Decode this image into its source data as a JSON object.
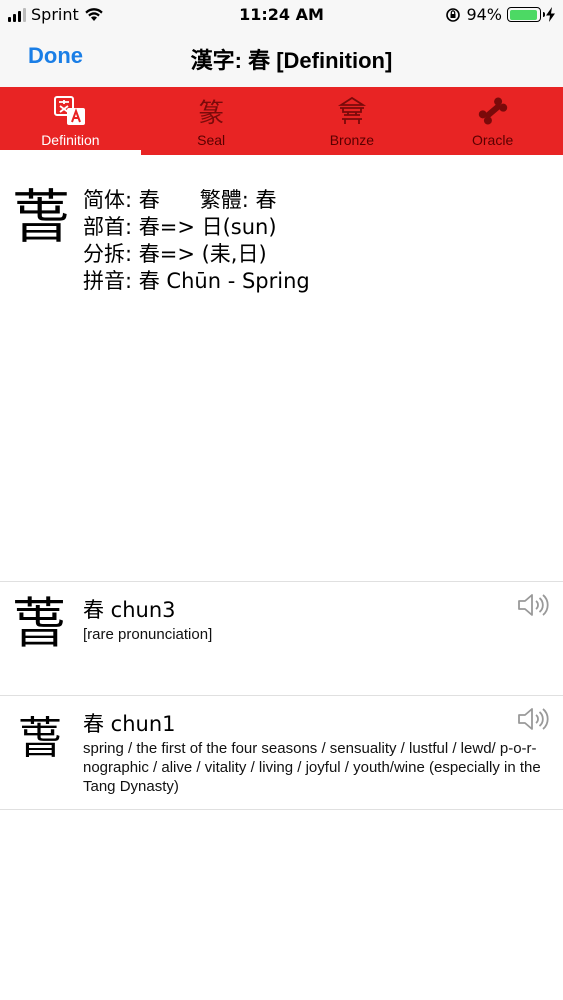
{
  "status": {
    "carrier": "Sprint",
    "time": "11:24 AM",
    "battery": "94%",
    "battery_level": 0.94,
    "icons": [
      "signal-icon",
      "wifi-icon",
      "orientation-lock-icon",
      "battery-icon",
      "charging-icon"
    ]
  },
  "nav": {
    "done_label": "Done",
    "title": "漢字: 春 [Definition]"
  },
  "tabs": [
    {
      "label": "Definition",
      "icon": "translate-icon",
      "active": true
    },
    {
      "label": "Seal",
      "icon": "seal-script-icon",
      "glyph": "篆",
      "active": false
    },
    {
      "label": "Bronze",
      "icon": "bronze-vessel-icon",
      "active": false
    },
    {
      "label": "Oracle",
      "icon": "bone-icon",
      "active": false
    }
  ],
  "colors": {
    "accent_blue": "#1a7ee6",
    "tab_red": "#e82424",
    "battery_green": "#4cd964"
  },
  "definition": {
    "character": "萅",
    "lines": [
      "简体: 春      繁體: 春",
      "部首: 春=> 日(sun)",
      "分拆: 春=> (耒,日)",
      "拼音: 春 Chūn - Spring"
    ]
  },
  "entries": [
    {
      "character": "萅",
      "title": "春  chun3",
      "description": "[rare pronunciation]"
    },
    {
      "character": "萅",
      "title": "春  chun1",
      "description": "spring / the first of the four seasons / sensuality / lustful / lewd/ p-o-r-nographic / alive / vitality / living / joyful / youth/wine (especially in the Tang Dynasty)"
    }
  ]
}
